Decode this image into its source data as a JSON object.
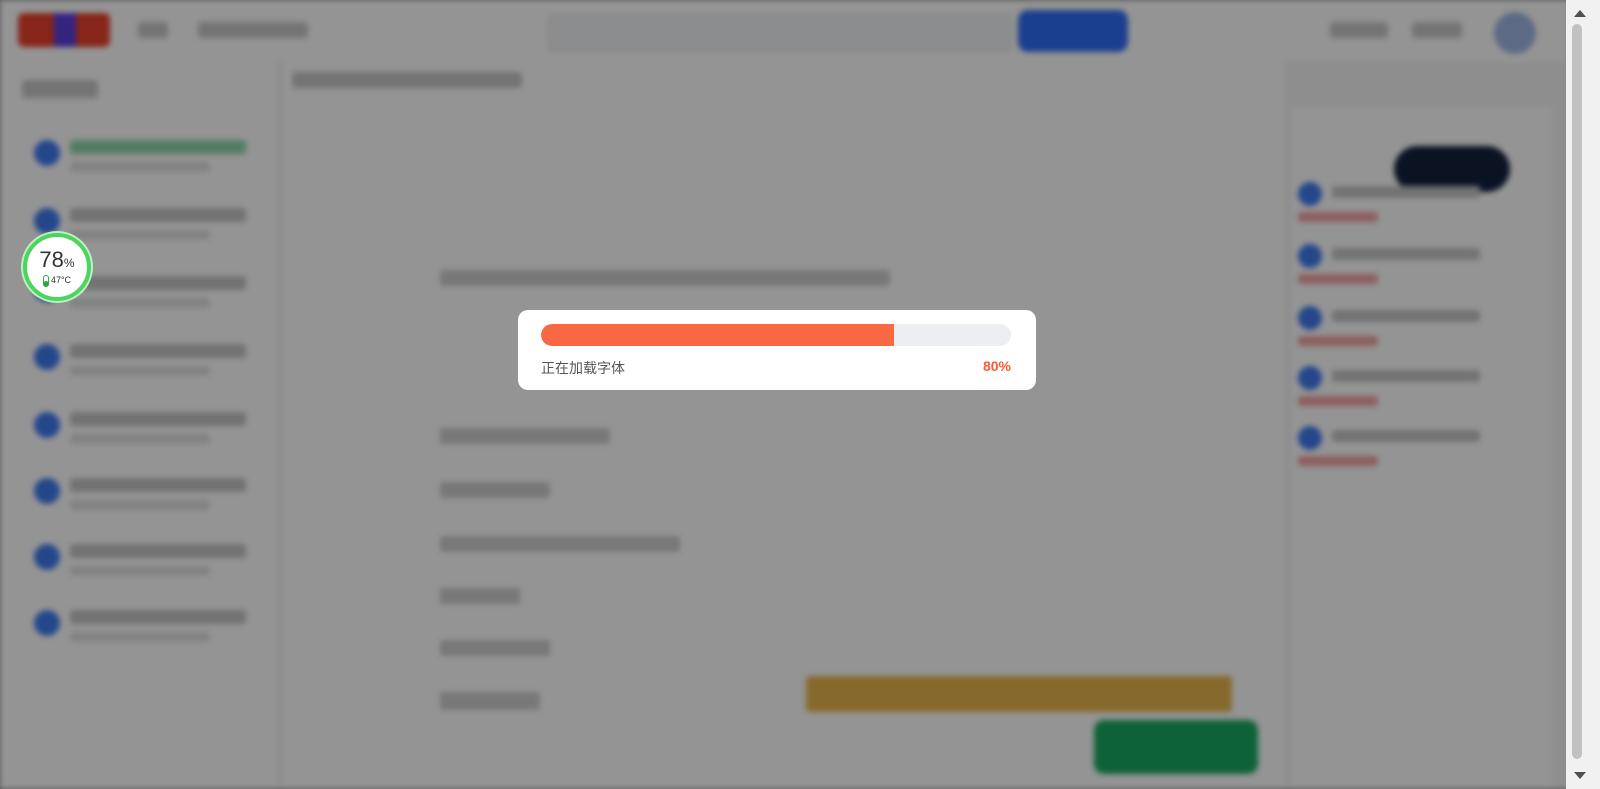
{
  "monitor": {
    "value": "78",
    "unit": "%",
    "temperature": "47°C",
    "icon": "thermometer-icon",
    "ring_color": "#4cd45f"
  },
  "loading_dialog": {
    "status_text": "正在加载字体",
    "percent_text": "80%",
    "progress": 0.75,
    "fill_color": "#fa6843",
    "track_color": "#edeef1",
    "percent_color": "#fa5a36"
  },
  "colors": {
    "overlay": "rgba(0,0,0,0.42)",
    "primary_blue": "#2f6df6",
    "cta_green": "#19a962",
    "banner_gold": "#e7b64c"
  }
}
